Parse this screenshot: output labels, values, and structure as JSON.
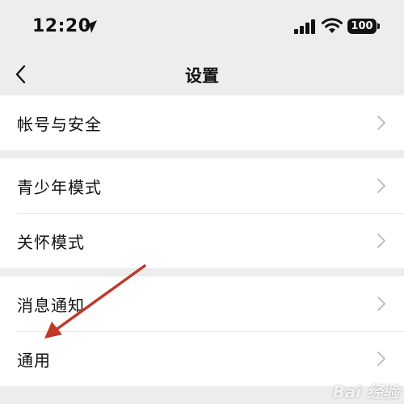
{
  "status_bar": {
    "time": "12:20",
    "battery": "100",
    "icons": [
      "location-arrow-icon",
      "signal-bars-icon",
      "wifi-icon",
      "battery-icon"
    ]
  },
  "nav": {
    "title": "设置",
    "back_icon": "chevron-left-icon"
  },
  "groups": [
    {
      "items": [
        {
          "label": "帐号与安全"
        }
      ]
    },
    {
      "items": [
        {
          "label": "青少年模式"
        },
        {
          "label": "关怀模式"
        }
      ]
    },
    {
      "items": [
        {
          "label": "消息通知"
        },
        {
          "label": "通用"
        }
      ]
    }
  ],
  "annotation": {
    "color": "#c0392b",
    "icon": "red-arrow-annotation"
  },
  "watermark": "Bai 经验",
  "colors": {
    "background": "#ededed",
    "row_background": "#ffffff",
    "chevron": "#b8b8b8"
  }
}
